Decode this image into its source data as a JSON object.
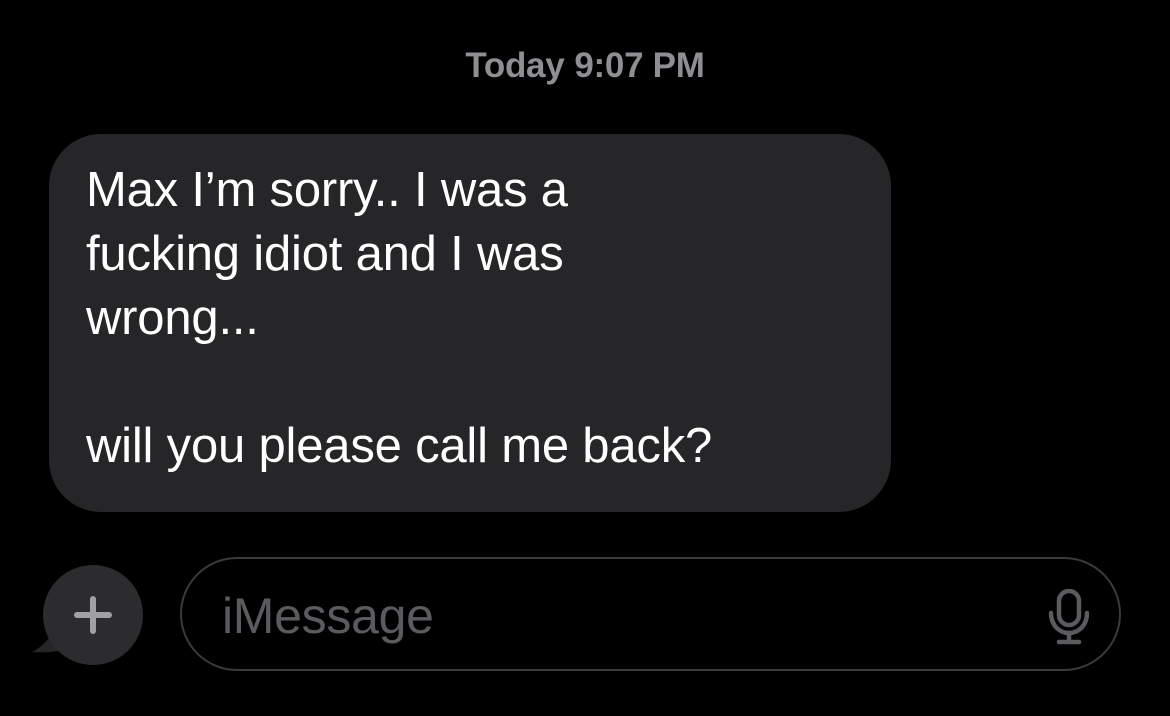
{
  "header": {
    "timestamp_day": "Today",
    "timestamp_time": "9:07 PM"
  },
  "messages": [
    {
      "direction": "incoming",
      "lines": [
        "Max I’m sorry.. I was a",
        "fucking idiot and I was",
        "wrong...",
        "",
        "will you please call me back?"
      ]
    }
  ],
  "compose": {
    "placeholder": "iMessage",
    "plus_icon": "plus-icon",
    "mic_icon": "microphone-icon"
  },
  "colors": {
    "background": "#000000",
    "incoming_bubble": "#262628",
    "timestamp_text": "#8e8e93",
    "placeholder_text": "#5b5b5f",
    "icon_gray": "#a0a0a5"
  }
}
